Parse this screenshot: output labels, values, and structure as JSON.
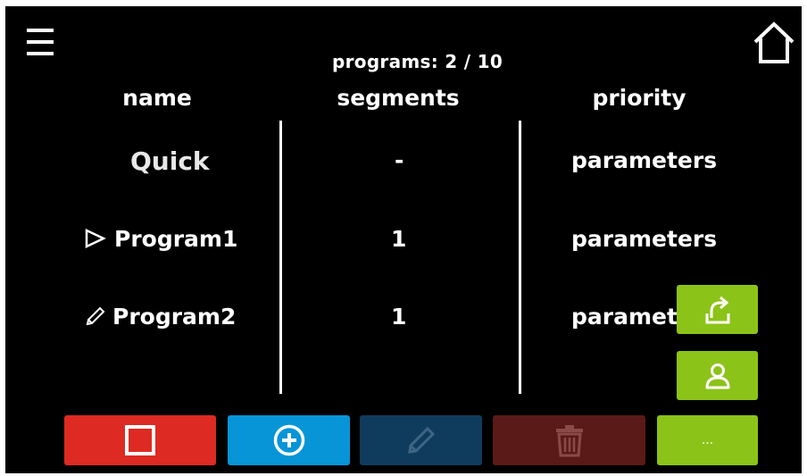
{
  "header": {
    "programs_count": "programs: 2 / 10"
  },
  "table": {
    "columns": [
      "name",
      "segments",
      "priority"
    ],
    "rows": [
      {
        "name": "Quick",
        "segments": "-",
        "priority": "parameters"
      },
      {
        "name": "Program1",
        "segments": "1",
        "priority": "parameters"
      },
      {
        "name": "Program2",
        "segments": "1",
        "priority": "parameters"
      }
    ]
  },
  "toolbar": {
    "more_label": "..."
  },
  "colors": {
    "background": "#000000",
    "stop": "#dd2a22",
    "add": "#0795d8",
    "edit_disabled": "#0f3c5c",
    "delete_disabled": "#5a1a18",
    "accent_green": "#8cc318"
  },
  "icons": {
    "menu": "menu-icon",
    "home": "home-icon",
    "row1": "play-triangle-icon",
    "row2": "pencil-icon",
    "export": "export-icon",
    "user": "user-icon",
    "stop": "stop-square-icon",
    "add": "plus-circle-icon",
    "edit": "pencil-icon",
    "delete": "trash-icon"
  }
}
